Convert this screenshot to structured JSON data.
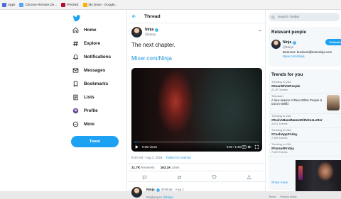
{
  "bookmarks": [
    {
      "label": "Apps",
      "color": "#4a6ee0"
    },
    {
      "label": "Chrome Remote De...",
      "color": "#5aa4f0"
    },
    {
      "label": "PHONE",
      "color": "#b2102f"
    },
    {
      "label": "My Drive - Google...",
      "color": "#f4b400"
    }
  ],
  "nav": {
    "items": [
      {
        "label": "Home",
        "icon": "home-icon"
      },
      {
        "label": "Explore",
        "icon": "hashtag-icon"
      },
      {
        "label": "Notifications",
        "icon": "bell-icon"
      },
      {
        "label": "Messages",
        "icon": "envelope-icon"
      },
      {
        "label": "Bookmarks",
        "icon": "bookmark-icon"
      },
      {
        "label": "Lists",
        "icon": "list-icon"
      },
      {
        "label": "Profile",
        "icon": "avatar-icon"
      },
      {
        "label": "More",
        "icon": "more-icon"
      }
    ],
    "tweet_button": "Tweet"
  },
  "thread": {
    "title": "Thread",
    "author_name": "Ninja",
    "author_handle": "@Ninja",
    "text": "The next chapter.",
    "link": "Mixer.com/Ninja",
    "video": {
      "views": "9.9M views",
      "time": "0:02 / 1:48",
      "progress_fraction": 0.02,
      "gif_label": "GIF"
    },
    "timestamp": "9:40 AM · Aug 1, 2019 ·",
    "source": "Twitter for Android",
    "retweets": "21.7K",
    "retweets_label": "Retweets",
    "likes": "163.1K",
    "likes_label": "Likes",
    "reply": {
      "name": "Ninja",
      "handle": "@Ninja · Aug 1",
      "replying_prefix": "Replying to",
      "replying_handle": "@Ninja"
    }
  },
  "search": {
    "placeholder": "Search Twitter"
  },
  "relevant": {
    "title": "Relevant people",
    "name": "Ninja",
    "handle": "@Ninja",
    "follow_label": "Following",
    "bio_line1": "Business: business@teamninja.com",
    "bio_link": "Mixer.com/Ninja"
  },
  "trends": {
    "title": "Trends for you",
    "items": [
      {
        "context": "Trending in USA",
        "name": "#DearWhitePeople",
        "count": "21.2K Tweets"
      },
      {
        "context": "Television",
        "desc": "A new season of Dear White People is out on Netflix"
      },
      {
        "context": "Trending in USA",
        "name": "#RuinABandNameWithOneLetter",
        "count": "3,031 Tweets"
      },
      {
        "context": "Trending in USA",
        "name": "#CashAppFriday",
        "count": "7,496 Tweets"
      },
      {
        "context": "Trending in USA",
        "name": "#FursuitFriday",
        "count": "7,496 Tweets"
      }
    ],
    "show_more": "Show more"
  },
  "footer": [
    "Terms",
    "Privacy policy"
  ],
  "colors": {
    "accent": "#1da1f2",
    "link": "#1b95e0",
    "text": "#14171a",
    "muted": "#657786"
  }
}
